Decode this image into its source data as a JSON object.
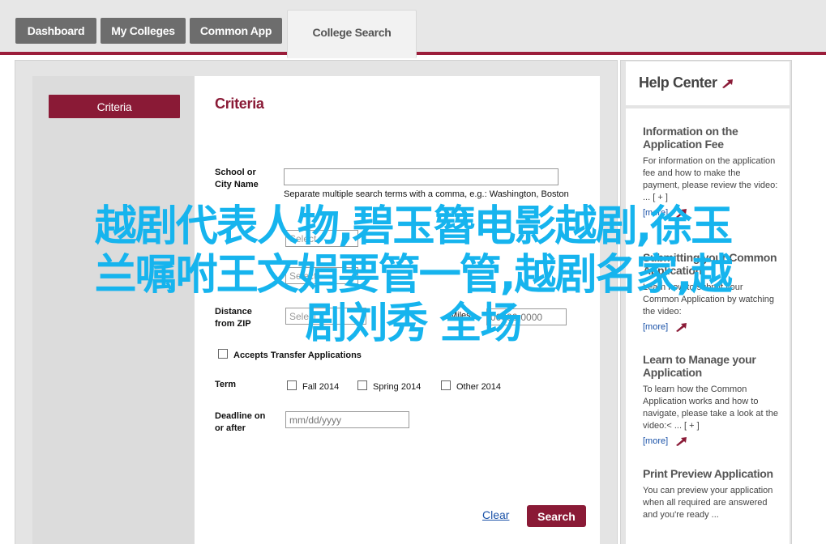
{
  "tabs": [
    {
      "label": "Dashboard"
    },
    {
      "label": "My Colleges"
    },
    {
      "label": "Common App"
    },
    {
      "label": "College Search"
    }
  ],
  "sidebar": {
    "criteria_button": "Criteria"
  },
  "form": {
    "title": "Criteria",
    "school_label": "School or City Name",
    "school_hint": "Separate multiple search terms with a comma, e.g.: Washington, Boston",
    "select_placeholder": "Select",
    "distance_label": "Distance from ZIP",
    "miles_label": "Miles",
    "zip_placeholder": "00000-0000",
    "transfer_label": "Accepts Transfer Applications",
    "term_label": "Term",
    "terms": [
      "Fall 2014",
      "Spring 2014",
      "Other 2014"
    ],
    "deadline_label": "Deadline on or after",
    "deadline_placeholder": "mm/dd/yyyy",
    "clear_label": "Clear",
    "search_label": "Search"
  },
  "help": {
    "title": "Help Center",
    "items": [
      {
        "title": "Information on the Application Fee",
        "desc": "For information on the application fee and how to make the payment, please review the video:",
        "extra": "... [ + ]",
        "more": "[more]"
      },
      {
        "title": "Submitting your Common Application",
        "desc": "Learn how to submit your Common Application by watching the video:",
        "more": "[more]"
      },
      {
        "title": "Learn to Manage your Application",
        "desc": "To learn how the Common Application works and how to navigate, please take a look at the video:< ... [ + ]",
        "more": "[more]"
      },
      {
        "title": "Print Preview Application",
        "desc": "You can preview your application when all required are answered and you're ready ..."
      }
    ]
  },
  "overlay": {
    "line1": "越剧代表人物,碧玉簪电影越剧,徐玉",
    "line2": "兰嘱咐王文娟要管一管,越剧名家,越",
    "line3": "剧刘秀  全场"
  },
  "colors": {
    "accent": "#8a1a36",
    "link": "#1a52a8",
    "overlay": "#16b4ee"
  }
}
